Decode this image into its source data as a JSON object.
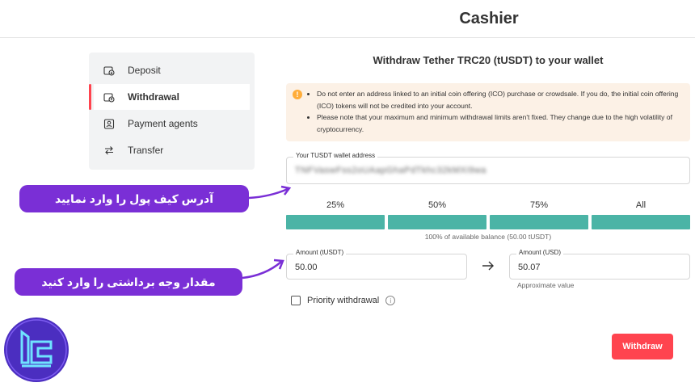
{
  "header": {
    "title": "Cashier"
  },
  "sidebar": {
    "items": [
      {
        "label": "Deposit",
        "icon": "deposit-icon"
      },
      {
        "label": "Withdrawal",
        "icon": "withdrawal-icon",
        "active": true
      },
      {
        "label": "Payment agents",
        "icon": "payment-agents-icon"
      },
      {
        "label": "Transfer",
        "icon": "transfer-icon"
      }
    ]
  },
  "form": {
    "title": "Withdraw Tether TRC20 (tUSDT) to your wallet",
    "warnings": [
      "Do not enter an address linked to an initial coin offering (ICO) purchase or crowdsale. If you do, the initial coin offering (ICO) tokens will not be credited into your account.",
      "Please note that your maximum and minimum withdrawal limits aren't fixed. They change due to the high volatility of cryptocurrency."
    ],
    "wallet_label": "Your TUSDT wallet address",
    "wallet_value": "TNFVaswFss2oUAapGhaPdTkhc32kMXi9wa",
    "percent_options": [
      "25%",
      "50%",
      "75%",
      "All"
    ],
    "balance_note": "100% of available balance (50.00 tUSDT)",
    "amount_label": "Amount (tUSDT)",
    "amount_value": "50.00",
    "amount_usd_label": "Amount (USD)",
    "amount_usd_value": "50.07",
    "approx_text": "Approximate value",
    "priority_label": "Priority withdrawal",
    "withdraw_button": "Withdraw"
  },
  "annotations": {
    "callout1": "آدرس کیف پول را وارد نمایید",
    "callout2": "مقدار وجه برداشتی را وارد کنید"
  },
  "colors": {
    "accent_red": "#ff444f",
    "bar_teal": "#4bb4a6",
    "callout_purple": "#7a2fd6",
    "warning_bg": "#fcf1e6"
  }
}
